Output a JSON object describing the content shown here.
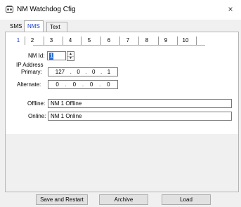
{
  "window": {
    "title": "NM Watchdog Cfig",
    "close_glyph": "×",
    "icon": "app-icon"
  },
  "tabs": [
    {
      "label": "SMS",
      "active": false
    },
    {
      "label": "NMS",
      "active": true
    },
    {
      "label": "Text Relay",
      "active": false
    }
  ],
  "subtabs": [
    "1",
    "2",
    "3",
    "4",
    "5",
    "6",
    "7",
    "8",
    "9",
    "10"
  ],
  "active_subtab": "1",
  "form": {
    "nm_id_label": "NM Id:",
    "nm_id_value": "1",
    "ip_address_label": "IP Address",
    "primary_label": "Primary:",
    "primary_octets": [
      "127",
      "0",
      "0",
      "1"
    ],
    "alternate_label": "Alternate:",
    "alternate_octets": [
      "0",
      "0",
      "0",
      "0"
    ],
    "offline_label": "Offline:",
    "offline_value": "NM 1 Offline",
    "online_label": "Online:",
    "online_value": "NM 1 Online"
  },
  "buttons": {
    "save_restart": "Save and Restart",
    "archive": "Archive",
    "load": "Load"
  },
  "colors": {
    "active_tab_text": "#1a3ec8",
    "selection": "#2f6fd4",
    "window_bg": "#f0f0f0"
  }
}
